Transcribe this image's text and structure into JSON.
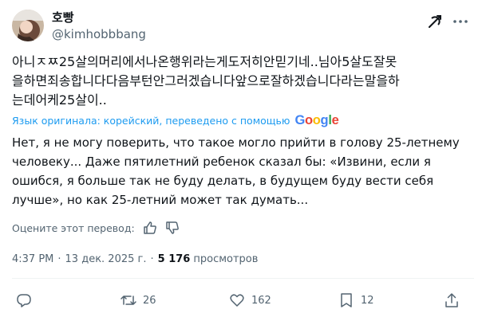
{
  "author": {
    "name": "호빵",
    "handle": "@kimhobbbang"
  },
  "original_text": {
    "lines": [
      "아니ㅈㅉ25살의머리에서나온행위라는게도저히안믿기네..님아5살도잘못",
      "을하면죄송합니다다음부턴안그러겠습니다앞으로잘하겠습니다라는말을하",
      "는데어케25살이.."
    ]
  },
  "translation_label": "Язык оригинала: корейский, переведено с помощью",
  "translation_provider": "Google",
  "translation": {
    "lines": [
      "Нет, я не могу поверить, что такое могло прийти в голову 25-летнему",
      "человеку... Даже пятилетний ребенок сказал бы: «Извини, если я",
      "ошибся, я больше так не буду делать, в будущем буду вести себя",
      "лучше», но как 25-летний может так думать..."
    ]
  },
  "rate_label": "Оцените этот перевод:",
  "meta": {
    "time": "4:37 PM",
    "date": "13 дек. 2025 г.",
    "views_count": "5 176",
    "views_label": "просмотров"
  },
  "actions": {
    "reply_count": "",
    "retweet_count": "26",
    "like_count": "162",
    "bookmark_count": "12"
  },
  "icons": [
    "avatar",
    "grok-icon",
    "more-icon",
    "thumbs-up-icon",
    "thumbs-down-icon",
    "reply-icon",
    "retweet-icon",
    "like-icon",
    "bookmark-icon",
    "share-icon"
  ],
  "colors": {
    "accent": "#1d9bf0",
    "secondary_text": "#536471",
    "primary_text": "#0f1419"
  }
}
